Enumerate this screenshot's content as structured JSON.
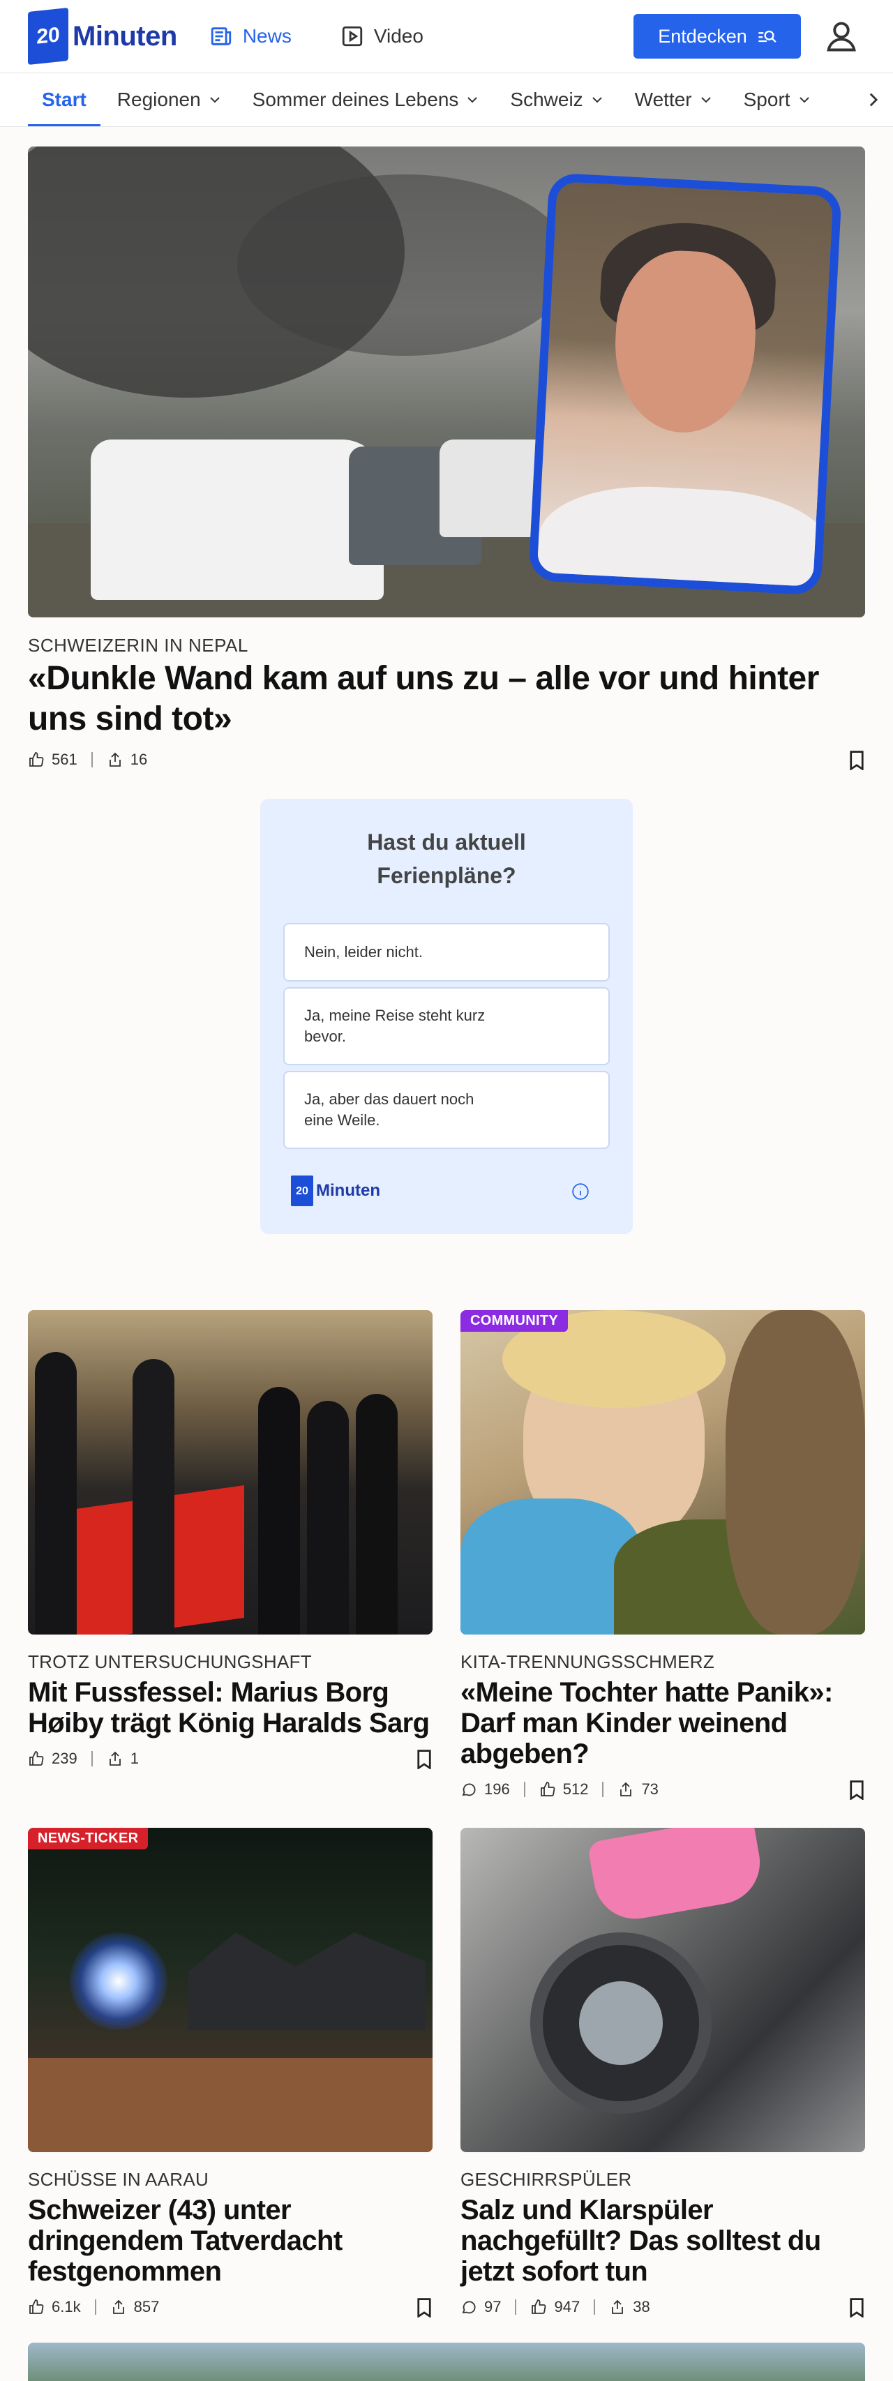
{
  "brand": {
    "name": "Minuten",
    "mark_top": "20",
    "mark_bottom": ""
  },
  "header": {
    "nav": [
      {
        "label": "News",
        "icon": "newspaper-icon",
        "active": true
      },
      {
        "label": "Video",
        "icon": "play-icon",
        "active": false
      }
    ],
    "discover_label": "Entdecken",
    "accent_color": "#2563eb"
  },
  "subnav": {
    "items": [
      {
        "label": "Start",
        "active": true
      },
      {
        "label": "Regionen",
        "dropdown": true
      },
      {
        "label": "Sommer deines Lebens",
        "dropdown": true
      },
      {
        "label": "Schweiz",
        "dropdown": true
      },
      {
        "label": "Wetter",
        "dropdown": true
      },
      {
        "label": "Sport",
        "dropdown": true
      }
    ]
  },
  "hero": {
    "kicker": "SCHWEIZERIN IN NEPAL",
    "title": "«Dunkle Wand kam auf uns zu – alle vor und hinter uns sind tot»",
    "likes": "561",
    "shares": "16"
  },
  "poll": {
    "title": "Hast du aktuell Ferienpläne?",
    "options": [
      "Nein, leider nicht.",
      "Ja, meine Reise steht kurz bevor.",
      "Ja, aber das dauert noch eine Weile."
    ],
    "brand": "Minuten",
    "background": "#e5efff"
  },
  "articles": [
    {
      "badge": "",
      "kicker": "TROTZ UNTERSUCHUNGSHAFT",
      "title": "Mit Fussfessel: Marius Borg Høiby trägt König Haralds Sarg",
      "comments": "",
      "likes": "239",
      "shares": "1"
    },
    {
      "badge": "COMMUNITY",
      "badge_color": "#8b2be2",
      "kicker": "KITA-TRENNUNGSSCHMERZ",
      "title": "«Meine Tochter hatte Panik»: Darf man Kinder weinend abgeben?",
      "comments": "196",
      "likes": "512",
      "shares": "73"
    },
    {
      "badge": "NEWS-TICKER",
      "badge_color": "#d6202a",
      "kicker": "SCHÜSSE IN AARAU",
      "title": "Schweizer (43) unter dringendem Tatverdacht festgenommen",
      "comments": "",
      "likes": "6.1k",
      "shares": "857"
    },
    {
      "badge": "",
      "kicker": "GESCHIRRSPÜLER",
      "title": "Salz und Klarspüler nachgefüllt? Das solltest du jetzt sofort tun",
      "comments": "97",
      "likes": "947",
      "shares": "38"
    }
  ]
}
